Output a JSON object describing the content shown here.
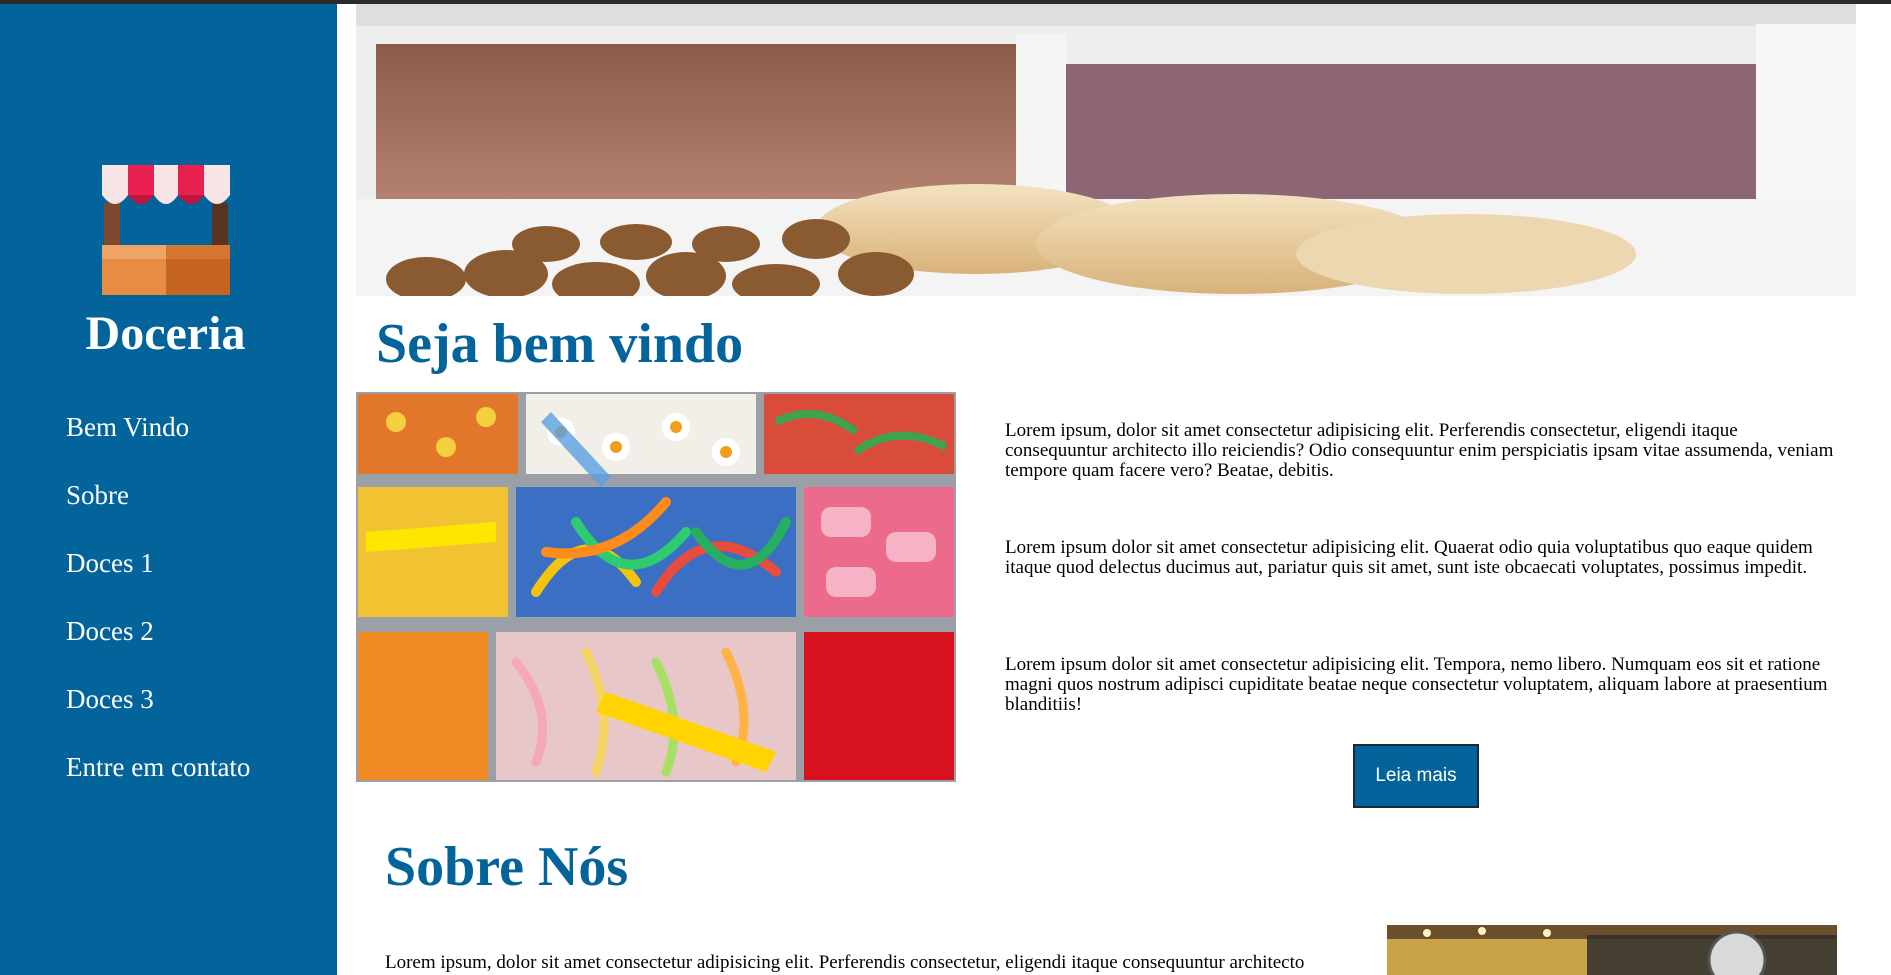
{
  "sidebar": {
    "brand": "Doceria",
    "logo_icon": "candy-shop-stall-icon",
    "nav": [
      {
        "label": "Bem Vindo"
      },
      {
        "label": "Sobre"
      },
      {
        "label": "Doces 1"
      },
      {
        "label": "Doces 2"
      },
      {
        "label": "Doces 3"
      },
      {
        "label": "Entre em contato"
      }
    ]
  },
  "welcome": {
    "title": "Seja bem vindo",
    "paragraphs": [
      "Lorem ipsum, dolor sit amet consectetur adipisicing elit. Perferendis consectetur, eligendi itaque consequuntur architecto illo reiciendis? Odio consequuntur enim perspiciatis ipsam vitae assumenda, veniam tempore quam facere vero? Beatae, debitis.",
      "Lorem ipsum dolor sit amet consectetur adipisicing elit. Quaerat odio quia voluptatibus quo eaque quidem itaque quod delectus ducimus aut, pariatur quis sit amet, sunt iste obcaecati voluptates, possimus impedit.",
      "Lorem ipsum dolor sit amet consectetur adipisicing elit. Tempora, nemo libero. Numquam eos sit et ratione magni quos nostrum adipisci cupiditate beatae neque consectetur voluptatem, aliquam labore at praesentium blanditiis!"
    ],
    "read_more": "Leia mais"
  },
  "about": {
    "title": "Sobre Nós",
    "paragraph": "Lorem ipsum, dolor sit amet consectetur adipisicing elit. Perferendis consectetur, eligendi itaque consequuntur architecto"
  },
  "colors": {
    "primary": "#03639b",
    "text": "#000000",
    "background": "#ffffff"
  }
}
